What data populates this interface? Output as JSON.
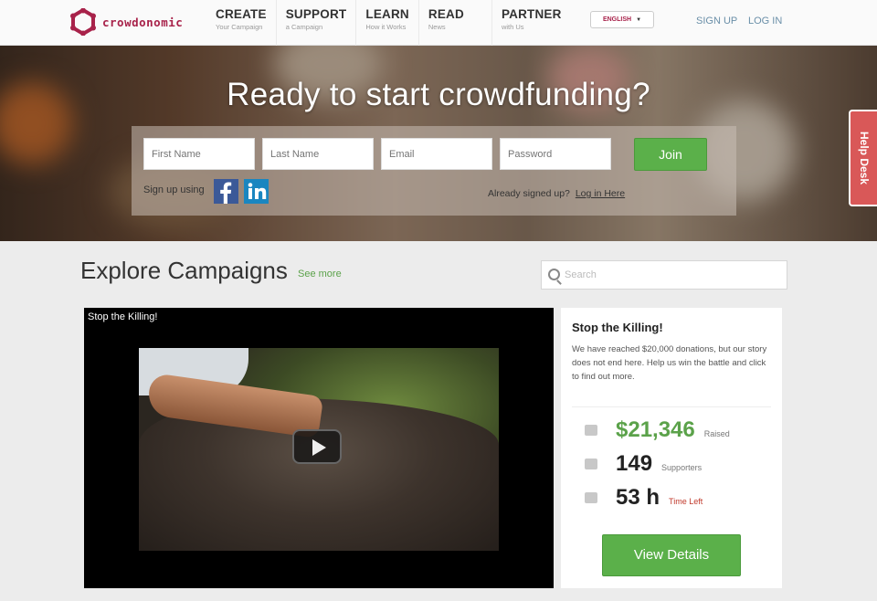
{
  "brand": {
    "name": "crowdonomic",
    "color": "#a8224a"
  },
  "nav": [
    {
      "title": "CREATE",
      "sub": "Your Campaign"
    },
    {
      "title": "SUPPORT",
      "sub": "a Campaign"
    },
    {
      "title": "LEARN",
      "sub": "How it Works"
    },
    {
      "title": "READ",
      "sub": "News"
    },
    {
      "title": "PARTNER",
      "sub": "with Us"
    }
  ],
  "language": {
    "selected": "ENGLISH",
    "icon": "chevron-down-icon"
  },
  "auth": {
    "signup": "SIGN UP",
    "login": "LOG IN"
  },
  "hero": {
    "title": "Ready to start crowdfunding?",
    "fields": {
      "first_name": "First Name",
      "last_name": "Last Name",
      "email": "Email",
      "password": "Password"
    },
    "join_label": "Join",
    "signup_using": "Sign up using",
    "already_text": "Already signed up?",
    "login_link": "Log in Here",
    "help_desk": "Help Desk"
  },
  "explore": {
    "title": "Explore Campaigns",
    "see_more": "See more",
    "search_placeholder": "Search"
  },
  "campaign": {
    "video_title": "Stop the Killing!",
    "title": "Stop the Killing!",
    "description": "We have reached $20,000 donations, but our story does not end here. Help us win the battle and click to find out more.",
    "raised_value": "$21,346",
    "raised_label": "Raised",
    "supporters_value": "149",
    "supporters_label": "Supporters",
    "time_value": "53 h",
    "time_label": "Time Left",
    "view_details": "View Details"
  },
  "colors": {
    "accent_green": "#5bb04a",
    "raised_green": "#5ba24a",
    "time_red": "#c0392b",
    "help_desk": "#d95858"
  }
}
